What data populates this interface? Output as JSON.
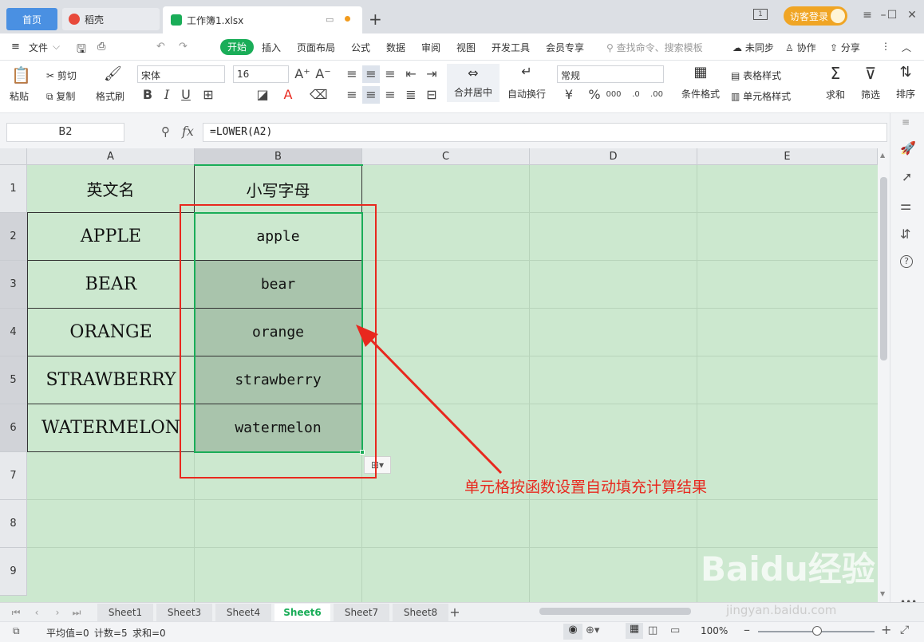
{
  "titlebar": {
    "home_tab": "首页",
    "daoke_tab": "稻壳",
    "doc_tab": "工作簿1.xlsx",
    "new_tab": "+",
    "login_label": "访客登录"
  },
  "menubar": {
    "file": "文件",
    "items": [
      "开始",
      "插入",
      "页面布局",
      "公式",
      "数据",
      "审阅",
      "视图",
      "开发工具",
      "会员专享"
    ],
    "search_placeholder": "查找命令、搜索模板",
    "sync": "未同步",
    "collab": "协作",
    "share": "分享"
  },
  "ribbon": {
    "paste": "粘贴",
    "cut": "剪切",
    "copy": "复制",
    "format_painter": "格式刷",
    "font_name": "宋体",
    "font_size": "16",
    "merge": "合并居中",
    "wrap": "自动换行",
    "number_format": "常规",
    "cond_format": "条件格式",
    "table_style": "表格样式",
    "cell_style": "单元格样式",
    "sum": "求和",
    "filter": "筛选",
    "sort": "排序"
  },
  "formula_bar": {
    "name_box": "B2",
    "fx_label": "fx",
    "formula": "=LOWER(A2)"
  },
  "columns": [
    "A",
    "B",
    "C",
    "D",
    "E"
  ],
  "rows": [
    "1",
    "2",
    "3",
    "4",
    "5",
    "6",
    "7",
    "8",
    "9"
  ],
  "table": {
    "header_a": "英文名",
    "header_b": "小写字母",
    "a_values": [
      "APPLE",
      "BEAR",
      "ORANGE",
      "STRAWBERRY",
      "WATERMELON"
    ],
    "b_values": [
      "apple",
      "bear",
      "orange",
      "strawberry",
      "watermelon"
    ]
  },
  "annotation": "单元格按函数设置自动填充计算结果",
  "sheets": [
    "Sheet1",
    "Sheet3",
    "Sheet4",
    "Sheet6",
    "Sheet7",
    "Sheet8"
  ],
  "active_sheet": "Sheet6",
  "status": {
    "average": "平均值=0",
    "count": "计数=5",
    "sum": "求和=0",
    "zoom": "100%"
  },
  "watermark": {
    "brand": "Baidu经验",
    "url": "jingyan.baidu.com"
  },
  "colors": {
    "grid_bg": "#cce8cf",
    "selection_border": "#1aad58",
    "annotation_red": "#e8281e",
    "start_tab_green": "#1aad58"
  }
}
